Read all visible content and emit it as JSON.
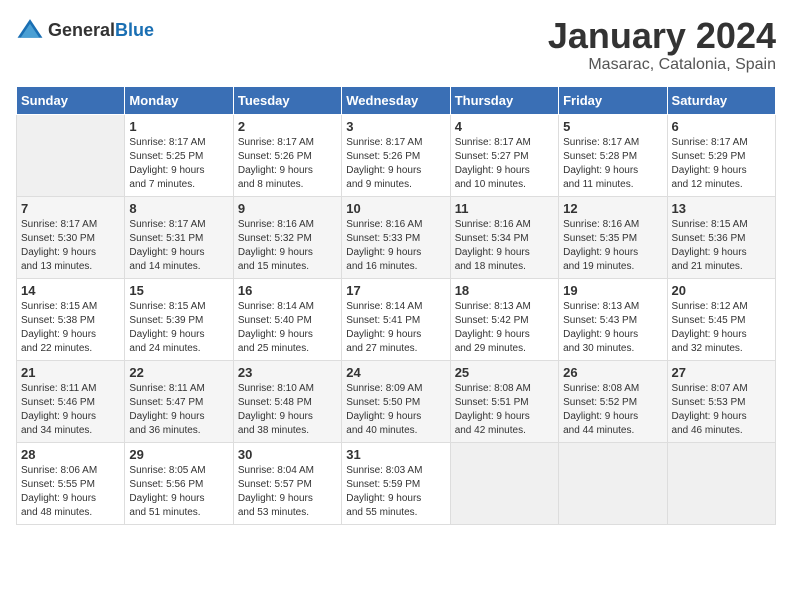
{
  "header": {
    "logo_general": "General",
    "logo_blue": "Blue",
    "title": "January 2024",
    "subtitle": "Masarac, Catalonia, Spain"
  },
  "days_of_week": [
    "Sunday",
    "Monday",
    "Tuesday",
    "Wednesday",
    "Thursday",
    "Friday",
    "Saturday"
  ],
  "weeks": [
    {
      "row_class": "week-row-1",
      "cells": [
        {
          "day": "",
          "content": ""
        },
        {
          "day": "1",
          "content": "Sunrise: 8:17 AM\nSunset: 5:25 PM\nDaylight: 9 hours\nand 7 minutes."
        },
        {
          "day": "2",
          "content": "Sunrise: 8:17 AM\nSunset: 5:26 PM\nDaylight: 9 hours\nand 8 minutes."
        },
        {
          "day": "3",
          "content": "Sunrise: 8:17 AM\nSunset: 5:26 PM\nDaylight: 9 hours\nand 9 minutes."
        },
        {
          "day": "4",
          "content": "Sunrise: 8:17 AM\nSunset: 5:27 PM\nDaylight: 9 hours\nand 10 minutes."
        },
        {
          "day": "5",
          "content": "Sunrise: 8:17 AM\nSunset: 5:28 PM\nDaylight: 9 hours\nand 11 minutes."
        },
        {
          "day": "6",
          "content": "Sunrise: 8:17 AM\nSunset: 5:29 PM\nDaylight: 9 hours\nand 12 minutes."
        }
      ]
    },
    {
      "row_class": "week-row-2",
      "cells": [
        {
          "day": "7",
          "content": "Sunrise: 8:17 AM\nSunset: 5:30 PM\nDaylight: 9 hours\nand 13 minutes."
        },
        {
          "day": "8",
          "content": "Sunrise: 8:17 AM\nSunset: 5:31 PM\nDaylight: 9 hours\nand 14 minutes."
        },
        {
          "day": "9",
          "content": "Sunrise: 8:16 AM\nSunset: 5:32 PM\nDaylight: 9 hours\nand 15 minutes."
        },
        {
          "day": "10",
          "content": "Sunrise: 8:16 AM\nSunset: 5:33 PM\nDaylight: 9 hours\nand 16 minutes."
        },
        {
          "day": "11",
          "content": "Sunrise: 8:16 AM\nSunset: 5:34 PM\nDaylight: 9 hours\nand 18 minutes."
        },
        {
          "day": "12",
          "content": "Sunrise: 8:16 AM\nSunset: 5:35 PM\nDaylight: 9 hours\nand 19 minutes."
        },
        {
          "day": "13",
          "content": "Sunrise: 8:15 AM\nSunset: 5:36 PM\nDaylight: 9 hours\nand 21 minutes."
        }
      ]
    },
    {
      "row_class": "week-row-3",
      "cells": [
        {
          "day": "14",
          "content": "Sunrise: 8:15 AM\nSunset: 5:38 PM\nDaylight: 9 hours\nand 22 minutes."
        },
        {
          "day": "15",
          "content": "Sunrise: 8:15 AM\nSunset: 5:39 PM\nDaylight: 9 hours\nand 24 minutes."
        },
        {
          "day": "16",
          "content": "Sunrise: 8:14 AM\nSunset: 5:40 PM\nDaylight: 9 hours\nand 25 minutes."
        },
        {
          "day": "17",
          "content": "Sunrise: 8:14 AM\nSunset: 5:41 PM\nDaylight: 9 hours\nand 27 minutes."
        },
        {
          "day": "18",
          "content": "Sunrise: 8:13 AM\nSunset: 5:42 PM\nDaylight: 9 hours\nand 29 minutes."
        },
        {
          "day": "19",
          "content": "Sunrise: 8:13 AM\nSunset: 5:43 PM\nDaylight: 9 hours\nand 30 minutes."
        },
        {
          "day": "20",
          "content": "Sunrise: 8:12 AM\nSunset: 5:45 PM\nDaylight: 9 hours\nand 32 minutes."
        }
      ]
    },
    {
      "row_class": "week-row-4",
      "cells": [
        {
          "day": "21",
          "content": "Sunrise: 8:11 AM\nSunset: 5:46 PM\nDaylight: 9 hours\nand 34 minutes."
        },
        {
          "day": "22",
          "content": "Sunrise: 8:11 AM\nSunset: 5:47 PM\nDaylight: 9 hours\nand 36 minutes."
        },
        {
          "day": "23",
          "content": "Sunrise: 8:10 AM\nSunset: 5:48 PM\nDaylight: 9 hours\nand 38 minutes."
        },
        {
          "day": "24",
          "content": "Sunrise: 8:09 AM\nSunset: 5:50 PM\nDaylight: 9 hours\nand 40 minutes."
        },
        {
          "day": "25",
          "content": "Sunrise: 8:08 AM\nSunset: 5:51 PM\nDaylight: 9 hours\nand 42 minutes."
        },
        {
          "day": "26",
          "content": "Sunrise: 8:08 AM\nSunset: 5:52 PM\nDaylight: 9 hours\nand 44 minutes."
        },
        {
          "day": "27",
          "content": "Sunrise: 8:07 AM\nSunset: 5:53 PM\nDaylight: 9 hours\nand 46 minutes."
        }
      ]
    },
    {
      "row_class": "week-row-5",
      "cells": [
        {
          "day": "28",
          "content": "Sunrise: 8:06 AM\nSunset: 5:55 PM\nDaylight: 9 hours\nand 48 minutes."
        },
        {
          "day": "29",
          "content": "Sunrise: 8:05 AM\nSunset: 5:56 PM\nDaylight: 9 hours\nand 51 minutes."
        },
        {
          "day": "30",
          "content": "Sunrise: 8:04 AM\nSunset: 5:57 PM\nDaylight: 9 hours\nand 53 minutes."
        },
        {
          "day": "31",
          "content": "Sunrise: 8:03 AM\nSunset: 5:59 PM\nDaylight: 9 hours\nand 55 minutes."
        },
        {
          "day": "",
          "content": ""
        },
        {
          "day": "",
          "content": ""
        },
        {
          "day": "",
          "content": ""
        }
      ]
    }
  ]
}
